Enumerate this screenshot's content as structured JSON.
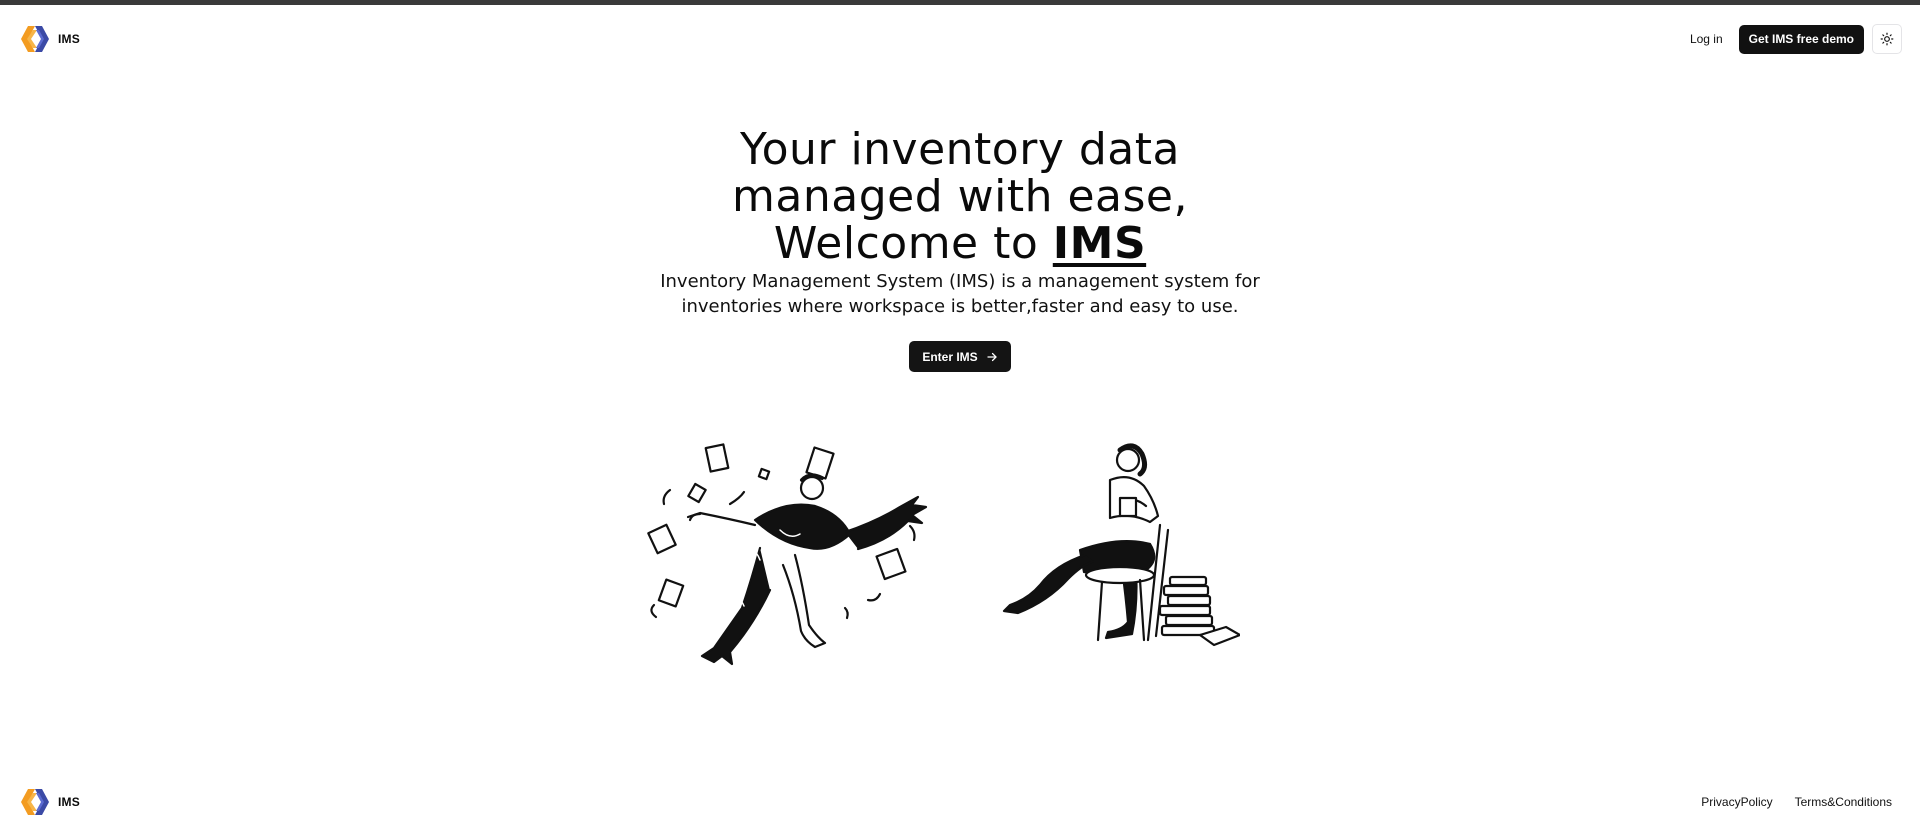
{
  "header": {
    "brand_name": "IMS",
    "login_label": "Log in",
    "demo_label": "Get IMS free demo",
    "theme_icon": "sun-icon"
  },
  "hero": {
    "title_line1": "Your inventory data",
    "title_line2": "managed with ease,",
    "title_line3_prefix": "Welcome to ",
    "title_line3_brand": "IMS",
    "description": "Inventory Management System (IMS) is a management system for inventories where workspace is better,faster and easy to use.",
    "enter_label": "Enter IMS",
    "enter_icon": "arrow-right-icon"
  },
  "footer": {
    "brand_name": "IMS",
    "links": [
      "PrivacyPolicy",
      "Terms&Conditions"
    ]
  },
  "colors": {
    "primary": "#111111",
    "logo_orange": "#f39c21",
    "logo_blue": "#3b4aa6",
    "background": "#ffffff"
  }
}
